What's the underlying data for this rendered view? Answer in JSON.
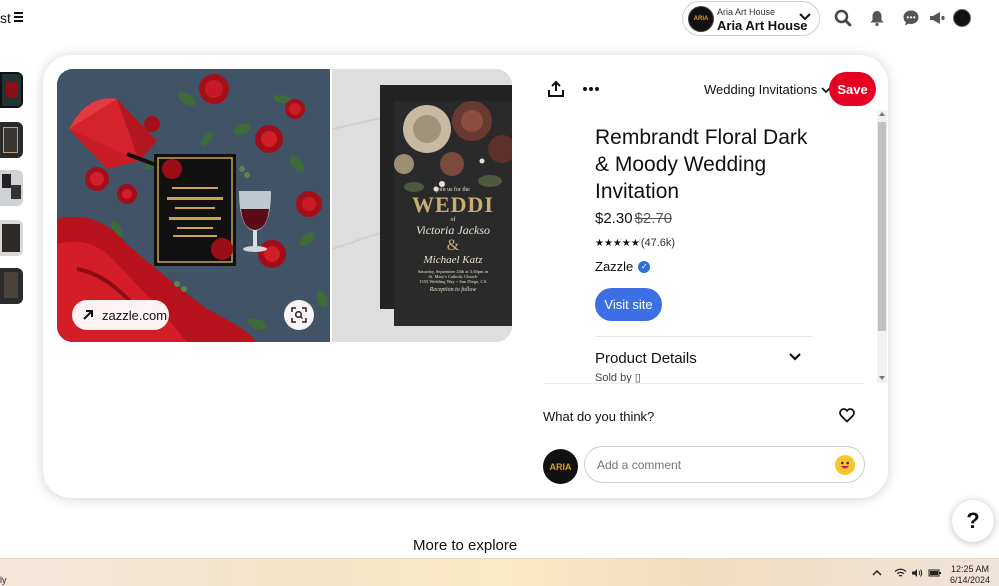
{
  "topbar": {
    "left_fragment": "st",
    "account_line1": "Aria Art House",
    "account_line2": "Aria Art House",
    "avatar_text": "ARIA"
  },
  "pin": {
    "source_label": "zazzle.com",
    "board_label": "Wedding Invitations",
    "save_label": "Save",
    "title": "Rembrandt Floral Dark & Moody Wedding Invitation",
    "price": "$2.30",
    "price_old": "$2.70",
    "stars": "★★★★★",
    "rating_count": "(47.6k)",
    "merchant": "Zazzle",
    "visit_label": "Visit site",
    "product_details_label": "Product Details",
    "sold_by": "Sold by ▯"
  },
  "image2": {
    "join": "join us for the",
    "wedding": "WEDDI",
    "of": "of",
    "name1": "Victoria Jackso",
    "amp": "&",
    "name2": "Michael Katz",
    "date": "Saturday, September 24th at 3:30pm in",
    "venue": "St. Mary's Catholic Church",
    "address": "1555 Wedding Way ~ San Diego, CA",
    "reception": "Reception to follow"
  },
  "comments": {
    "prompt": "What do you think?",
    "placeholder": "Add a comment",
    "avatar_text": "ARIA"
  },
  "help_label": "?",
  "explore_label": "More to explore",
  "taskbar": {
    "left_fragment": "ly",
    "time": "12:25 AM",
    "date": "6/14/2024"
  },
  "colors": {
    "save": "#e60023",
    "visit": "#3b6fe3",
    "verified": "#2f6fd6"
  }
}
